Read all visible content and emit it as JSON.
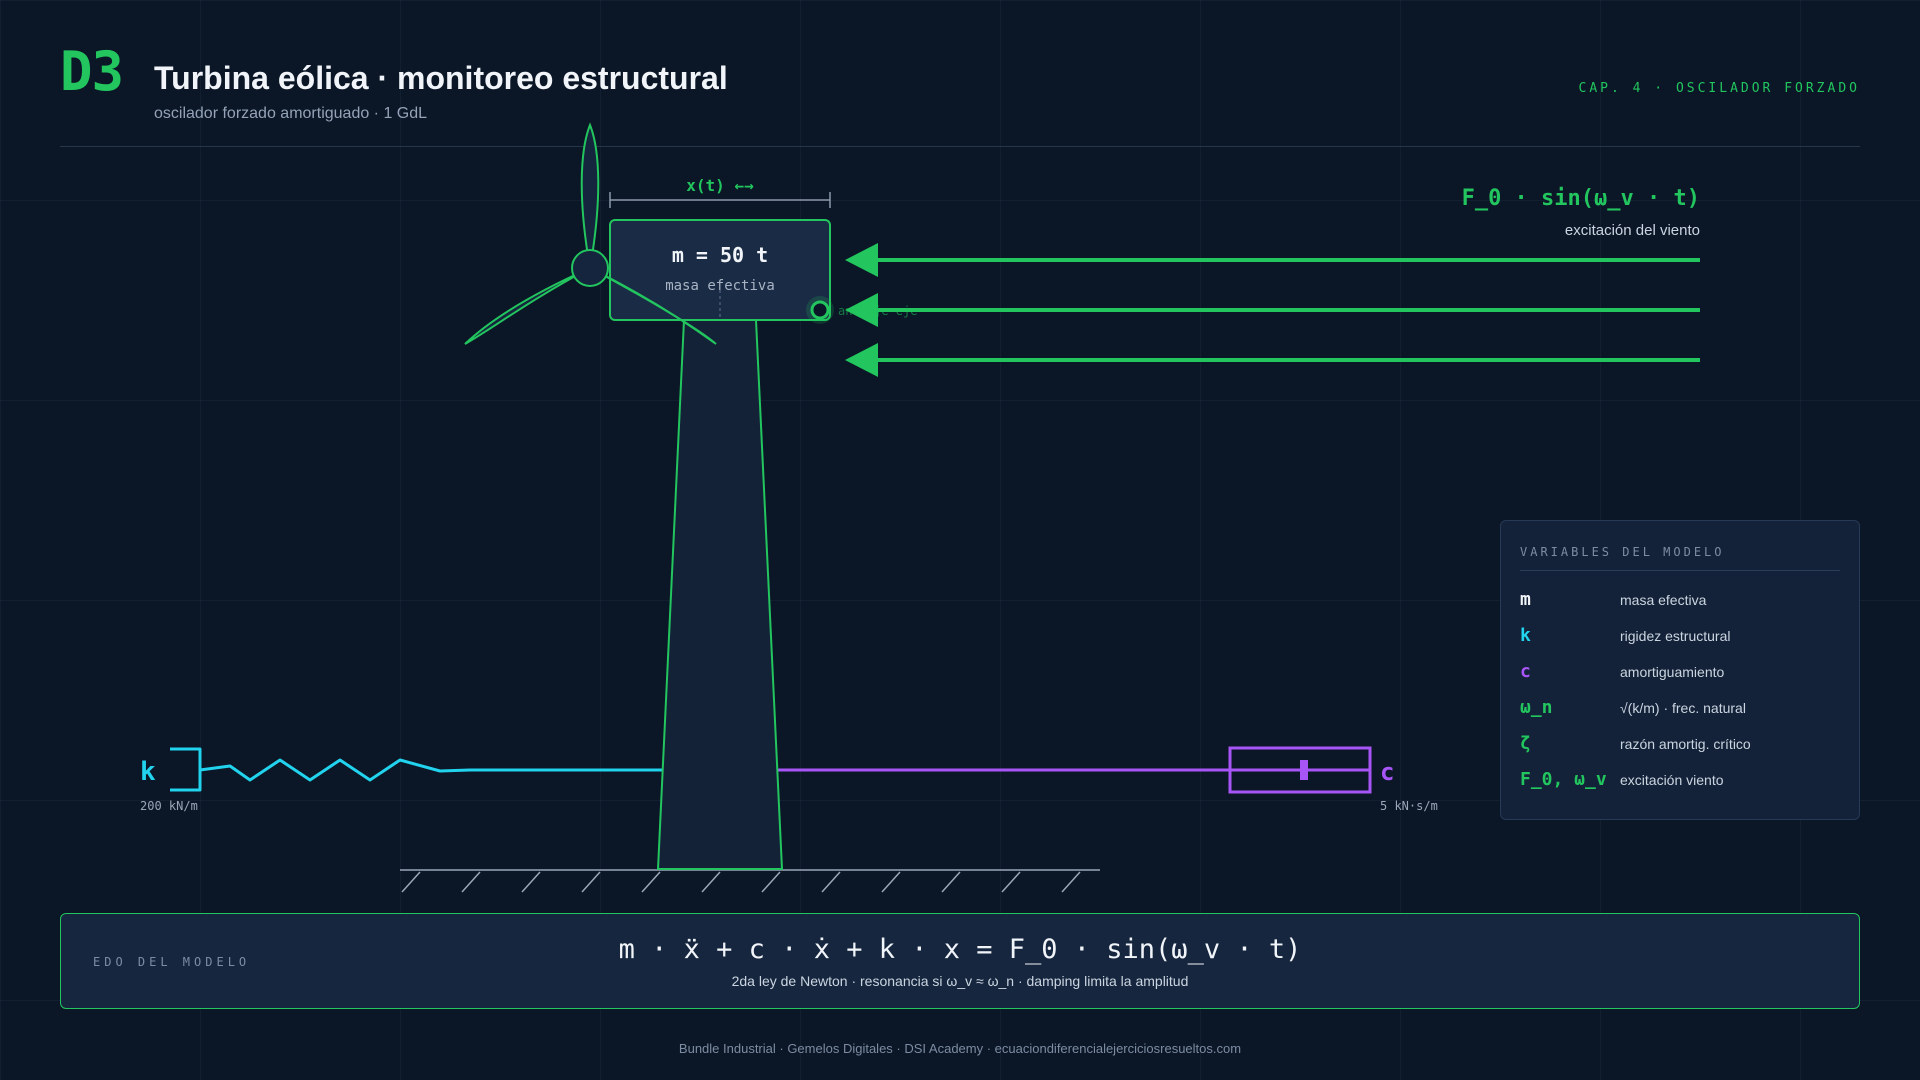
{
  "header": {
    "badge": "D3",
    "title": "Turbina eólica · monitoreo estructural",
    "subtitle": "oscilador forzado amortiguado · 1 GdL",
    "chapter": "CAP. 4 · OSCILADOR FORZADO"
  },
  "diagram": {
    "displacement_label": "x(t) ←→",
    "mass_value": "m = 50 t",
    "mass_caption": "masa efectiva",
    "hub_label": "anclaje eje",
    "force_label": "F_0 · sin(ω_v · t)",
    "force_caption": "excitación del viento",
    "spring_symbol": "k",
    "spring_value": "200 kN/m",
    "damper_symbol": "c",
    "damper_value": "5 kN·s/m"
  },
  "variables": {
    "title": "VARIABLES DEL MODELO",
    "items": [
      {
        "symbol": "m",
        "desc": "masa efectiva",
        "color": "#f1f5f9"
      },
      {
        "symbol": "k",
        "desc": "rigidez estructural",
        "color": "#22d3ee"
      },
      {
        "symbol": "c",
        "desc": "amortiguamiento",
        "color": "#a855f7"
      },
      {
        "symbol": "ω_n",
        "desc": "√(k/m) · frec. natural",
        "color": "#22c55e"
      },
      {
        "symbol": "ζ",
        "desc": "razón amortig. crítico",
        "color": "#22c55e"
      },
      {
        "symbol": "F_0, ω_v",
        "desc": "excitación viento",
        "color": "#22c55e"
      }
    ]
  },
  "equation": {
    "label": "EDO DEL MODELO",
    "main": "m · ẍ + c · ẋ + k · x = F_0 · sin(ω_v · t)",
    "caption": "2da ley de Newton · resonancia si ω_v ≈ ω_n · damping limita la amplitud"
  },
  "footer": "Bundle Industrial · Gemelos Digitales · DSI Academy · ecuaciondiferencialejerciciosresueltos.com",
  "colors": {
    "accent": "#22c55e",
    "spring": "#22d3ee",
    "damper": "#a855f7",
    "background": "#0b1626"
  }
}
